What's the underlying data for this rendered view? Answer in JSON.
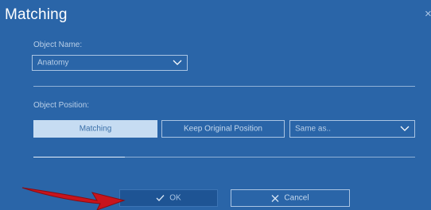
{
  "dialog": {
    "title": "Matching"
  },
  "object_name": {
    "label": "Object Name:",
    "selected": "Anatomy"
  },
  "object_position": {
    "label": "Object Position:",
    "options": [
      "Matching",
      "Keep Original Position"
    ],
    "active_option": "Matching",
    "same_as": "Same as.."
  },
  "progress": {
    "fraction": 0.24
  },
  "footer": {
    "ok_label": "OK",
    "cancel_label": "Cancel"
  },
  "colors": {
    "background": "#2a65a8",
    "active_button": "#c6dcf2",
    "pointer_arrow": "#c8141c"
  },
  "icons": [
    "close-icon",
    "chevron-down-icon",
    "check-icon",
    "x-icon",
    "pointer-arrow"
  ]
}
